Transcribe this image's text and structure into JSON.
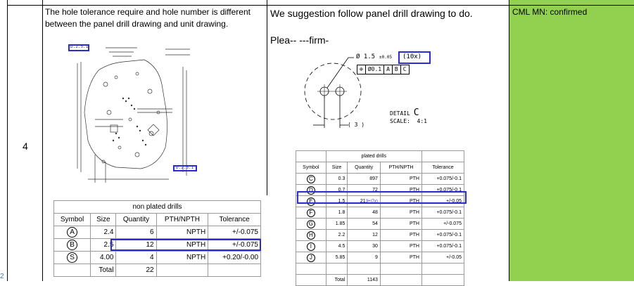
{
  "row_number": "4",
  "col_issue": {
    "text": "The hole tolerance require and hole number is different between the panel drill drawing and unit drawing."
  },
  "col_suggestion": {
    "text": "We suggestion follow panel drill drawing to do.",
    "confirm_text": "Plea-- ---firm-"
  },
  "col_status": {
    "text": "CML MN: confirmed"
  },
  "detail": {
    "dia": "Ø 1.5",
    "tol": "±0.05",
    "count": "(10x)",
    "fcf_pos": "⊕",
    "fcf_tol": "Ø0.1",
    "fcf_a": "A",
    "fcf_b": "B",
    "fcf_c": "C",
    "label": "DETAIL",
    "letter": "C",
    "scale_label": "SCALE:",
    "scale_value": "4:1",
    "dim_value": "( 3 )"
  },
  "non_plated": {
    "title": "non plated drills",
    "headers": [
      "Symbol",
      "Size",
      "Quantity",
      "PTH/NPTH",
      "Tolerance"
    ],
    "rows": [
      [
        "A",
        "2.4",
        "6",
        "NPTH",
        "+/-0.075"
      ],
      [
        "B",
        "2.5",
        "12",
        "NPTH",
        "+/-0.075"
      ],
      [
        "S",
        "4.00",
        "4",
        "NPTH",
        "+0.20/-0.00"
      ]
    ],
    "total_label": "Total",
    "total_value": "22"
  },
  "plated": {
    "title": "plated drills",
    "headers": [
      "Symbol",
      "Size",
      "Quantity",
      "PTH/NPTH",
      "Tolerance"
    ],
    "rows": [
      [
        "C",
        "0.3",
        "897",
        "PTH",
        "+0.075/-0.1"
      ],
      [
        "D",
        "0.7",
        "72",
        "PTH",
        "+0.075/-0.1"
      ],
      [
        "E",
        "1.5",
        "21",
        "PTH",
        "+/-0.05"
      ],
      [
        "F",
        "1.8",
        "48",
        "PTH",
        "+0.075/-0.1"
      ],
      [
        "G",
        "1.85",
        "54",
        "PTH",
        "+/-0.075"
      ],
      [
        "H",
        "2.2",
        "12",
        "PTH",
        "+0.075/-0.1"
      ],
      [
        "I",
        "4.5",
        "30",
        "PTH",
        "+0.075/-0.1"
      ],
      [
        "J",
        "5.85",
        "9",
        "PTH",
        "+/-0.05"
      ]
    ],
    "qty_annotation": "3+(7x)",
    "total_label": "Total",
    "total_value": "1143"
  },
  "drawing": {
    "label_top": "D.2.5.1",
    "label_bottom": "D.2.5.1"
  }
}
